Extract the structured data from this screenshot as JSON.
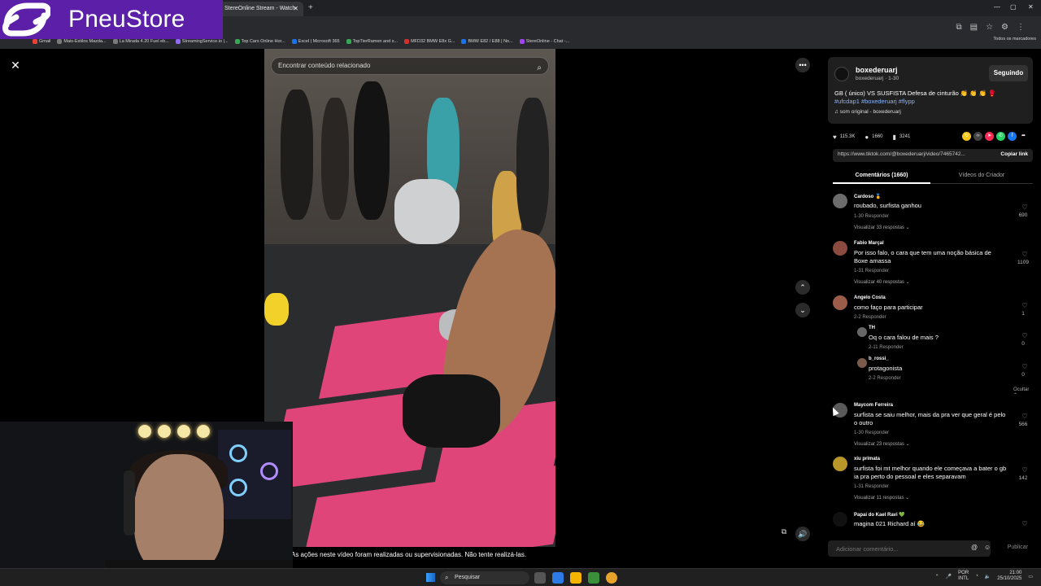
{
  "browser": {
    "active_tab": "StereOnline Stream - Watch Li...",
    "tab_close": "✕",
    "new_tab": "+",
    "bookmarks": [
      "Gmail",
      "Mais-Estilos Mazda...",
      "La Mirada 4.20 Fuel eb...",
      "StreamingService.io |...",
      "Top Cars Online Hor...",
      "Excel | Microsoft 365",
      "TopTierRamen and s...",
      "MFD32 BMW E8x G...",
      "BMW E82 / E88 | No...",
      "StereOnline - Chat -..."
    ],
    "all_bookmarks": "Todos os marcadores"
  },
  "logo": {
    "text": "PneuStore"
  },
  "video": {
    "search_placeholder": "Encontrar conteúdo relacionado",
    "disclaimer": "As ações neste vídeo foram realizadas ou supervisionadas. Não tente realizá-las."
  },
  "author": {
    "name": "boxederuarj",
    "sub": "boxederuarj · 1-30",
    "follow_label": "Seguindo",
    "caption": "GB ( único) VS SUSFISTA Defesa de cinturão 👏 👏 👏 🥊",
    "tags": "#ufcdap1 #boxederuarj #flypp",
    "sound": "♫  som original - boxederuarj"
  },
  "stats": {
    "likes": "115.3K",
    "comments": "1660",
    "saves": "3241"
  },
  "share": {
    "url": "https://www.tiktok.com/@boxederuarj/video/7465742...",
    "copy_label": "Copiar link"
  },
  "tabs": {
    "comments": "Comentários (1660)",
    "creator": "Vídeos do Criador"
  },
  "comments": [
    {
      "user": "Cardoso 🏅",
      "text": "roubado, surfista ganhou",
      "meta": "1-30    Responder",
      "replies": "Visualizar 33 respostas ⌄",
      "likes": "690"
    },
    {
      "user": "Fabio Marçal",
      "text": "Por isso falo, o cara que tem uma noção básica de Boxe amassa",
      "meta": "1-31    Responder",
      "replies": "Visualizar 40 respostas ⌄",
      "likes": "1109"
    },
    {
      "user": "Angelo Costa",
      "text": "como faço para participar",
      "meta": "2-2    Responder",
      "likes": "1"
    },
    {
      "user": "TH",
      "text": "Oq o cara falou de mais ?",
      "meta": "2-11    Responder",
      "likes": "0"
    },
    {
      "user": "b_rossi_",
      "text": "protagonista",
      "meta": "2-2    Responder",
      "likes": "0"
    },
    {
      "user": "Maycom Ferreira",
      "text": "surfista se saiu melhor, mais da pra ver que geral é pelo o outro",
      "meta": "1-30    Responder",
      "replies": "Visualizar 23 respostas ⌄",
      "likes": "566"
    },
    {
      "user": "xiu primata",
      "text": "surfista foi mt melhor quando ele começava a bater o gb ia pra perto do pessoal e eles separavam",
      "meta": "1-31    Responder",
      "replies": "Visualizar 11 respostas ⌄",
      "likes": "142"
    },
    {
      "user": "Papai do Kael Ravi 💚",
      "text": "magina 021 Richard aí 😂",
      "likes": ""
    }
  ],
  "hide_label": "Ocultar ⌃",
  "input": {
    "placeholder": "Adicionar comentário...",
    "publish": "Publicar"
  },
  "taskbar": {
    "search": "Pesquisar",
    "lang1": "POR",
    "lang2": "INTL",
    "time": "21:00",
    "date": "25/10/2025"
  }
}
